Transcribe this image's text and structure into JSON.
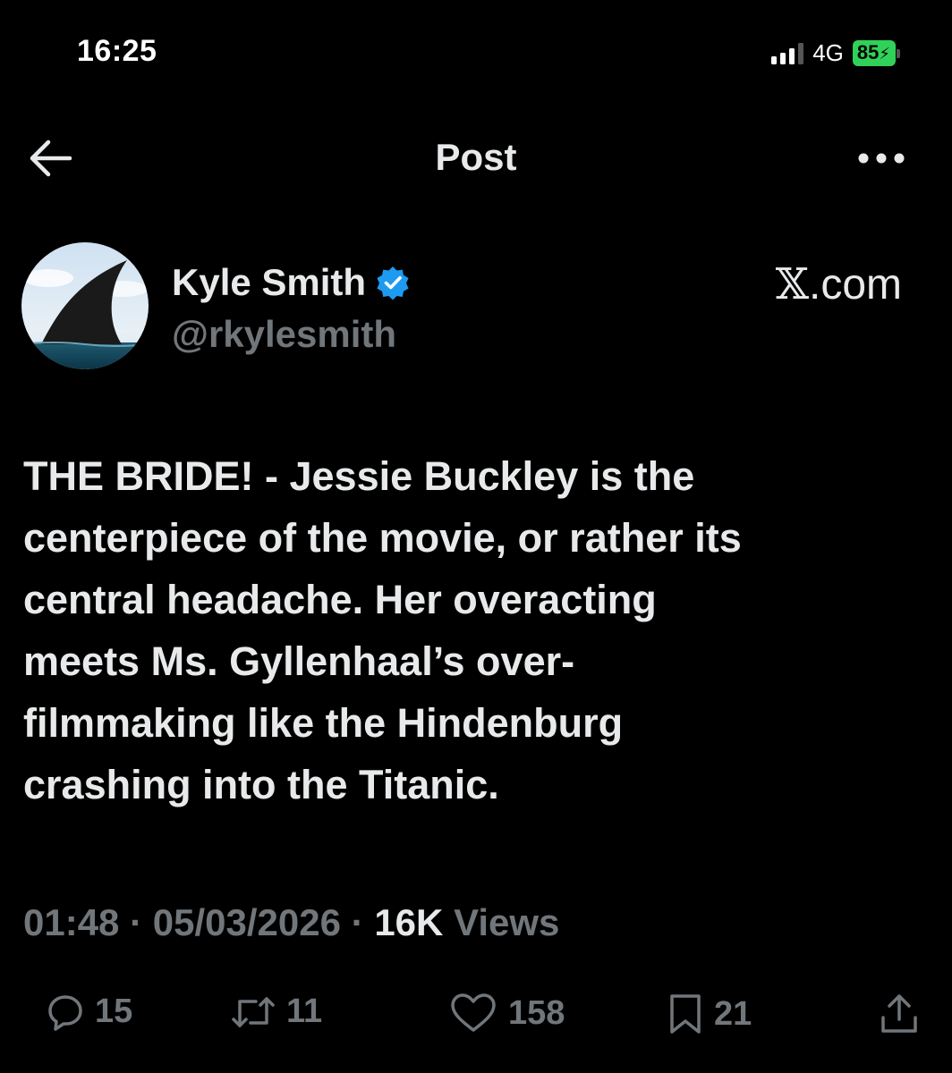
{
  "status_bar": {
    "time": "16:25",
    "network": "4G",
    "battery": "85",
    "battery_color": "#30d158"
  },
  "header": {
    "title": "Post",
    "back_icon": "arrow-left-icon",
    "more_icon": "more-horizontal-icon"
  },
  "author": {
    "name": "Kyle Smith",
    "handle": "@rkylesmith",
    "verified": true,
    "verified_color": "#1d9bf0",
    "avatar_icon": "shark-fin-avatar"
  },
  "brand": {
    "logo_letter": "𝕏",
    "suffix": ".com"
  },
  "post": {
    "text": "THE BRIDE! - Jessie Buckley is the\ncenterpiece of the movie, or rather its\ncentral headache. Her overacting\nmeets Ms. Gyllenhaal’s over-\nfilmmaking like the Hindenburg\ncrashing into the Titanic."
  },
  "meta": {
    "time": "01:48",
    "date": "05/03/2026",
    "separator": "·",
    "views_count": "16K",
    "views_label": "Views"
  },
  "actions": {
    "replies": "15",
    "reposts": "11",
    "likes": "158",
    "bookmarks": "21"
  },
  "colors": {
    "background": "#000000",
    "text_primary": "#e7e9ea",
    "text_secondary": "#71767b"
  }
}
